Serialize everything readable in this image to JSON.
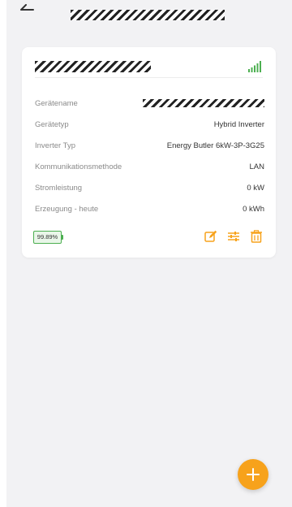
{
  "header": {
    "title": "",
    "back_icon": "arrow-left-icon"
  },
  "device_card": {
    "title": "",
    "signal_icon": "signal-strength-icon",
    "signal_color": "#4caf50",
    "rows": [
      {
        "label": "Gerätename",
        "value": ""
      },
      {
        "label": "Gerätetyp",
        "value": "Hybrid Inverter"
      },
      {
        "label": "Inverter Typ",
        "value": "Energy Butler 6kW-3P-3G25"
      },
      {
        "label": "Kommunikationsmethode",
        "value": "LAN"
      },
      {
        "label": "Stromleistung",
        "value": "0 kW"
      },
      {
        "label": "Erzeugung - heute",
        "value": "0 kWh"
      }
    ],
    "battery_level": "99.89%",
    "actions": [
      "edit-icon",
      "settings-sliders-icon",
      "trash-icon"
    ],
    "accent_color": "#f7a21b"
  },
  "fab": {
    "icon": "plus-icon",
    "color": "#f7a21b"
  }
}
